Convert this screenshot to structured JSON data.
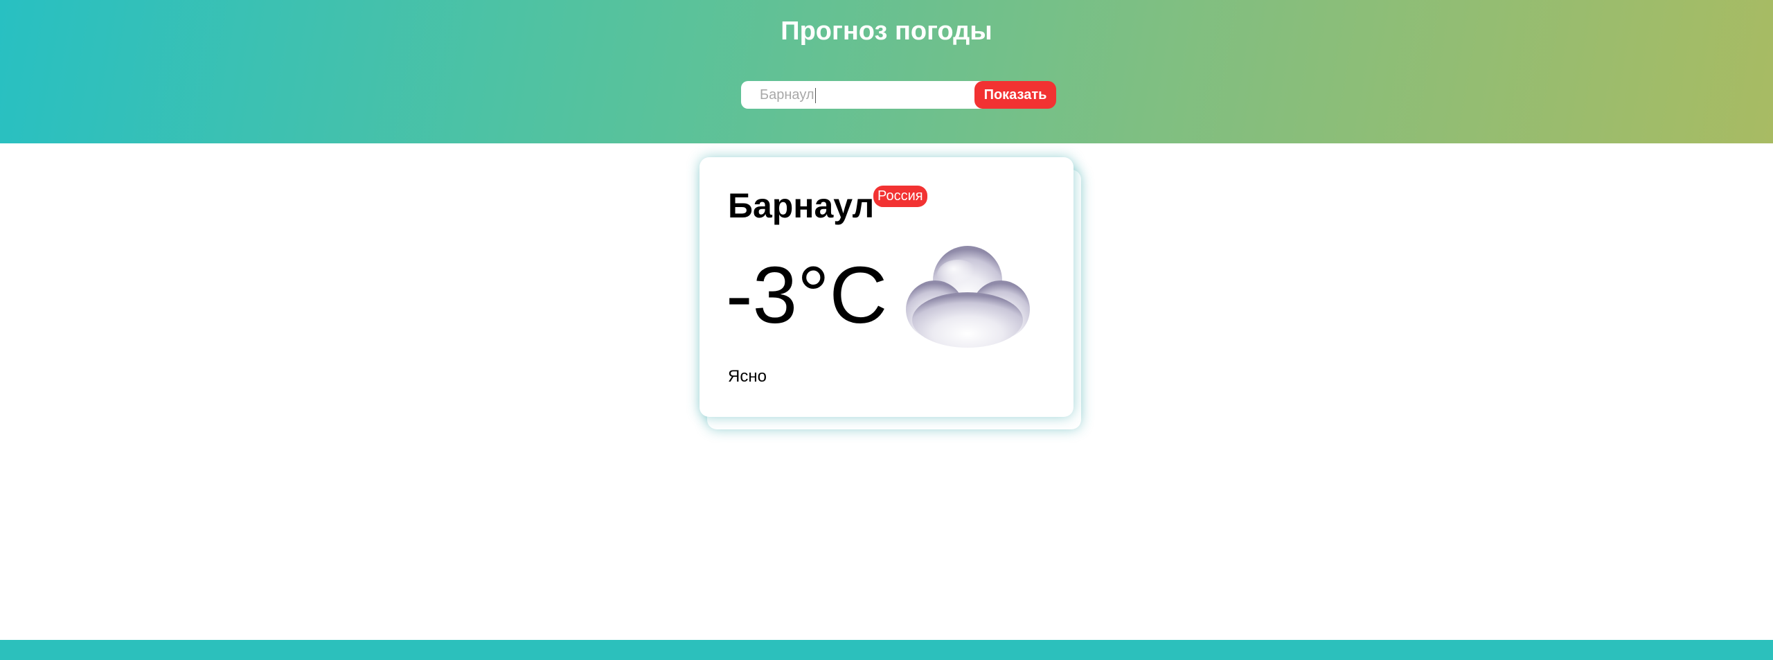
{
  "header": {
    "title": "Прогноз погоды",
    "search": {
      "value": "Барнаул",
      "button_label": "Показать"
    }
  },
  "weather_card": {
    "city": "Барнаул",
    "country": "Россия",
    "temperature": "-3°C",
    "description": "Ясно",
    "icon": "cloud-icon"
  },
  "colors": {
    "header_gradient_start": "#28c0c2",
    "header_gradient_end": "#a8bb63",
    "accent_red": "#f23232",
    "footer": "#2cc0bc"
  }
}
